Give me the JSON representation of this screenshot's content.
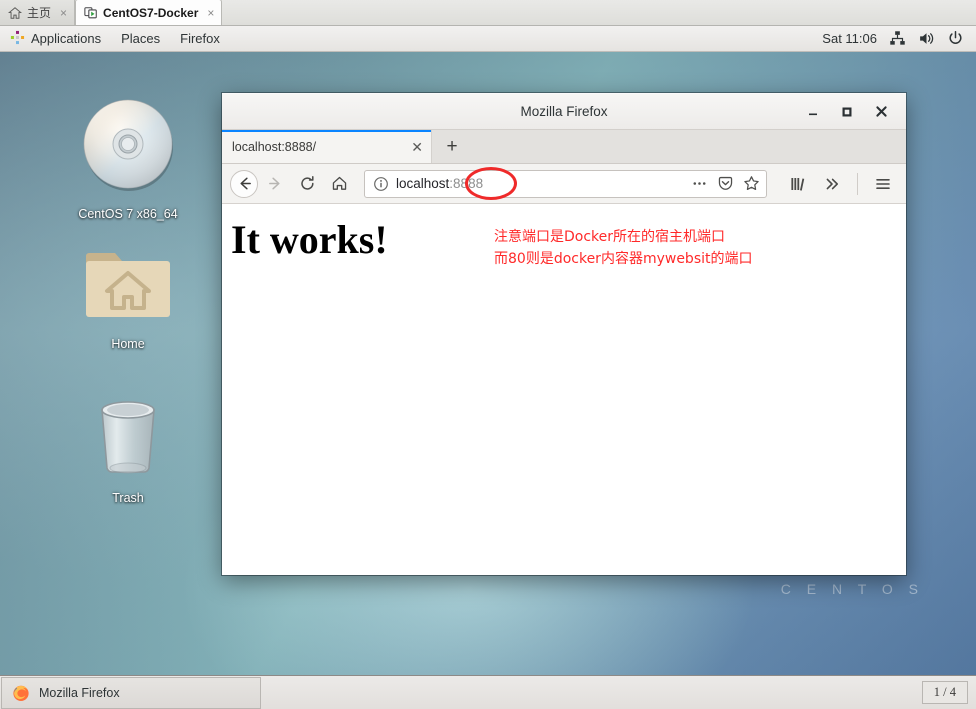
{
  "vm_tabbar": {
    "tabs": [
      {
        "label": "主页",
        "icon": "home-icon",
        "active": false,
        "close": "×"
      },
      {
        "label": "CentOS7-Docker",
        "icon": "vm-screen-icon",
        "active": true,
        "close": "×"
      }
    ]
  },
  "gnome_panel": {
    "applications": "Applications",
    "places": "Places",
    "firefox": "Firefox",
    "clock": "Sat 11:06",
    "tray": [
      "network-icon",
      "volume-icon",
      "power-icon"
    ]
  },
  "desktop": {
    "watermark": "C E N T O S",
    "icons": [
      {
        "label": "CentOS 7 x86_64",
        "icon": "cd-disc-icon"
      },
      {
        "label": "Home",
        "icon": "home-folder-icon"
      },
      {
        "label": "Trash",
        "icon": "trash-bin-icon"
      }
    ]
  },
  "firefox": {
    "window_title": "Mozilla Firefox",
    "window_controls": {
      "minimize": "–",
      "maximize": "□",
      "close": "✕"
    },
    "tab": {
      "label": "localhost:8888/",
      "close": "✕"
    },
    "new_tab": "+",
    "nav": {
      "back": "back-arrow-icon",
      "forward": "forward-arrow-icon",
      "reload": "reload-icon",
      "home": "home-icon"
    },
    "urlbar": {
      "identity_icon": "info-circle-icon",
      "host": "localhost",
      "port": ":8888",
      "full_url": "localhost:8888",
      "page_actions": "ellipsis-icon",
      "pocket": "pocket-icon",
      "bookmark": "star-icon",
      "annotation_color": "#ef2a2a"
    },
    "toolbar_end": {
      "library": "library-icon",
      "overflow": "chevron-double-right-icon",
      "menu": "hamburger-menu-icon"
    },
    "page": {
      "heading": "It works!",
      "note_line1": "注意端口是Docker所在的宿主机端口",
      "note_line2": "而80则是docker内容器mywebsit的端口",
      "note_color": "#ff2a2a"
    }
  },
  "taskbar": {
    "window_button": {
      "label": "Mozilla Firefox",
      "icon": "firefox-logo-icon"
    },
    "workspace": "1 / 4"
  }
}
